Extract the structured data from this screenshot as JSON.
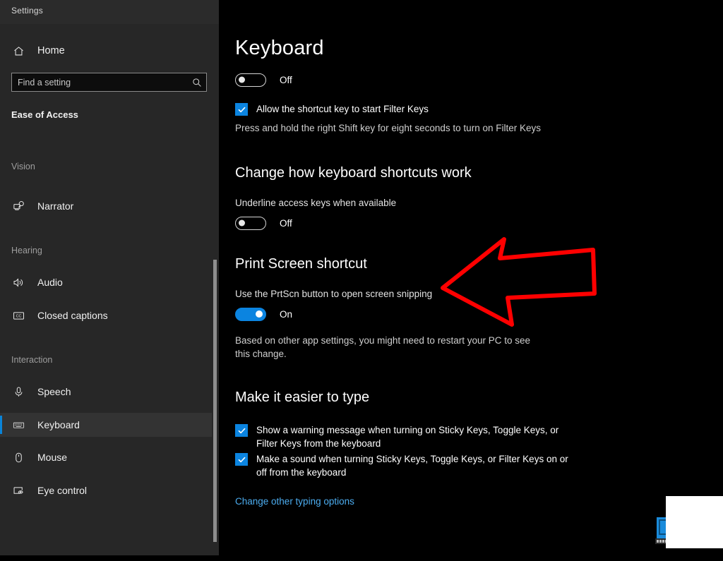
{
  "window": {
    "title": "Settings"
  },
  "sidebar": {
    "home": {
      "label": "Home",
      "icon": "home-icon"
    },
    "search": {
      "placeholder": "Find a setting",
      "value": "",
      "icon": "search-icon"
    },
    "section_title": "Ease of Access",
    "groups": [
      {
        "label": "Vision",
        "items": [
          {
            "label": "Narrator",
            "icon": "narrator-icon",
            "selected": false
          }
        ]
      },
      {
        "label": "Hearing",
        "items": [
          {
            "label": "Audio",
            "icon": "audio-speaker-icon",
            "selected": false
          },
          {
            "label": "Closed captions",
            "icon": "closed-captions-icon",
            "selected": false
          }
        ]
      },
      {
        "label": "Interaction",
        "items": [
          {
            "label": "Speech",
            "icon": "microphone-icon",
            "selected": false
          },
          {
            "label": "Keyboard",
            "icon": "keyboard-icon",
            "selected": true
          },
          {
            "label": "Mouse",
            "icon": "mouse-icon",
            "selected": false
          },
          {
            "label": "Eye control",
            "icon": "eye-control-icon",
            "selected": false
          }
        ]
      }
    ],
    "scrollbar": {
      "name": "sidebar-scrollbar"
    }
  },
  "main": {
    "page_title": "Keyboard",
    "sticky_keys_toggle": {
      "state": "Off",
      "on": false
    },
    "filter_keys_checkbox": {
      "label": "Allow the shortcut key to start Filter Keys",
      "checked": true
    },
    "filter_keys_help": "Press and hold the right Shift key for eight seconds to turn on Filter Keys",
    "shortcuts_section": {
      "heading": "Change how keyboard shortcuts work",
      "underline_label": "Underline access keys when available",
      "underline_toggle": {
        "state": "Off",
        "on": false
      }
    },
    "print_screen_section": {
      "heading": "Print Screen shortcut",
      "description": "Use the PrtScn button to open screen snipping",
      "toggle": {
        "state": "On",
        "on": true
      },
      "note": "Based on other app settings, you might need to restart your PC to see this change."
    },
    "easier_to_type_section": {
      "heading": "Make it easier to type",
      "checkboxes": [
        {
          "label": "Show a warning message when turning on Sticky Keys, Toggle Keys, or Filter Keys from the keyboard",
          "checked": true
        },
        {
          "label": "Make a sound when turning Sticky Keys, Toggle Keys, or Filter Keys on or off from the keyboard",
          "checked": true
        }
      ],
      "link": "Change other typing options"
    }
  },
  "annotation": {
    "arrow": {
      "name": "red-arrow-annotation",
      "direction": "left",
      "color": "#FF0000"
    }
  },
  "colors": {
    "accent": "#0B84E0",
    "sidebar_bg": "#272727",
    "content_bg": "#000000",
    "link": "#4CADF0",
    "annotation_red": "#FF0000"
  }
}
